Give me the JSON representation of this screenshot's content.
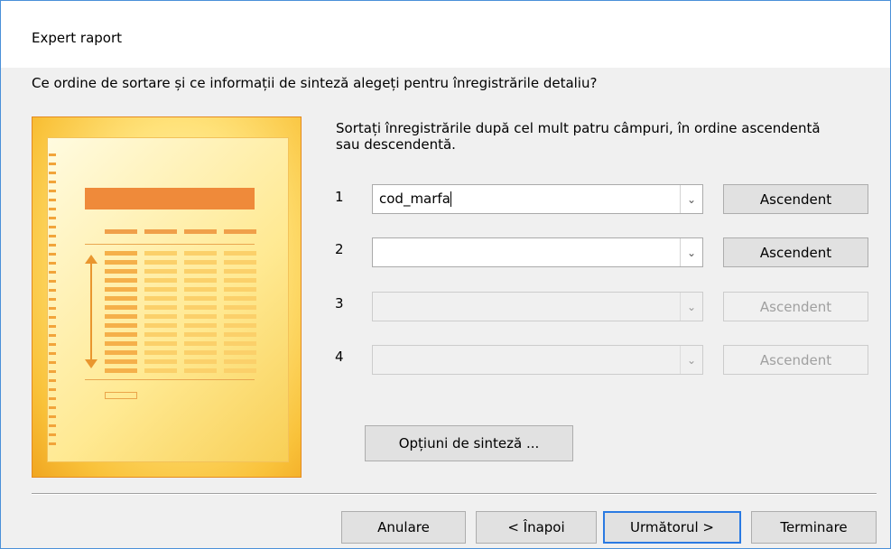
{
  "window": {
    "title": "Expert raport",
    "question": "Ce ordine de sortare și ce informații de sinteză alegeți pentru înregistrările detaliu?"
  },
  "instructions": "Sortați înregistrările după cel mult patru câmpuri, în ordine ascendentă sau descendentă.",
  "sort_fields": [
    {
      "number": "1",
      "value": "cod_marfa",
      "enabled": true,
      "order_label": "Ascendent"
    },
    {
      "number": "2",
      "value": "",
      "enabled": true,
      "order_label": "Ascendent"
    },
    {
      "number": "3",
      "value": "",
      "enabled": false,
      "order_label": "Ascendent"
    },
    {
      "number": "4",
      "value": "",
      "enabled": false,
      "order_label": "Ascendent"
    }
  ],
  "summary_button": "Opțiuni de sinteză ...",
  "footer": {
    "cancel": "Anulare",
    "back": "< Înapoi",
    "next": "Următorul >",
    "finish": "Terminare"
  },
  "icons": {
    "dropdown": "chevron-down-icon"
  },
  "colors": {
    "accent_border": "#2a7ae2",
    "illustration_orange": "#ef8a3a"
  }
}
